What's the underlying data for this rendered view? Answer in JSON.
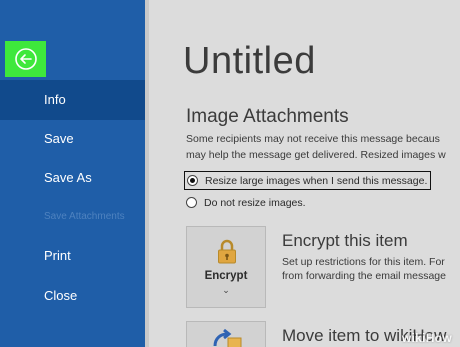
{
  "sidebar": {
    "back_icon": "arrow-left-circle-icon",
    "items": [
      {
        "label": "Info"
      },
      {
        "label": "Save"
      },
      {
        "label": "Save As"
      },
      {
        "label": "Save Attachments"
      },
      {
        "label": "Print"
      },
      {
        "label": "Close"
      }
    ]
  },
  "main": {
    "title": "Untitled",
    "image_attachments": {
      "heading": "Image Attachments",
      "description_line1": "Some recipients may not receive this message becaus",
      "description_line2": "may help the message get delivered. Resized images w",
      "options": [
        {
          "label": "Resize large images when I send this message.",
          "selected": true
        },
        {
          "label": "Do not resize images.",
          "selected": false
        }
      ]
    },
    "encrypt": {
      "tile_label": "Encrypt",
      "tile_chevron": "⌄",
      "tile_icon": "padlock-icon",
      "heading": "Encrypt this item",
      "description_line1": "Set up restrictions for this item. For",
      "description_line2": "from forwarding the email message"
    },
    "move": {
      "tile_icon": "move-to-folder-icon",
      "heading": "Move item to wikiHow"
    }
  },
  "watermark": "wikiHow",
  "colors": {
    "sidebar": "#1f5ea8",
    "sidebar_active": "#114a8c",
    "back_highlight": "#3ee83c",
    "content_bg": "#dcdcdc"
  }
}
